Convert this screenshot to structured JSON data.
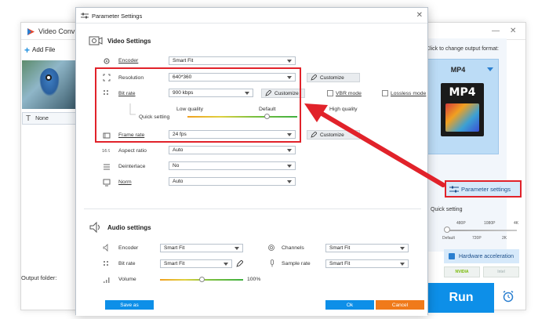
{
  "app": {
    "title": "Video Conv",
    "add_files": "Add File",
    "subtitle_value": "None",
    "output_folder_label": "Output folder:",
    "run_label": "Run"
  },
  "right_panel": {
    "change_format_label": "Click to change output format:",
    "format_name": "MP4",
    "format_icon_text": "MP4",
    "parameter_settings_label": "Parameter settings",
    "quick_setting_label": "Quick setting",
    "quick_scale_top": [
      "480P",
      "1080P",
      "4K"
    ],
    "quick_scale_bottom": [
      "Default",
      "720P",
      "2K"
    ],
    "hw_accel_label": "Hardware acceleration",
    "gpu_nvidia": "NVIDIA",
    "gpu_intel": "Intel"
  },
  "dialog": {
    "title": "Parameter Settings",
    "video_section": "Video Settings",
    "audio_section": "Audio settings",
    "video": {
      "encoder_label": "Encoder",
      "encoder_value": "Smart Fit",
      "resolution_label": "Resolution",
      "resolution_value": "640*360",
      "customize": "Customize",
      "bitrate_label": "Bit rate",
      "bitrate_value": "900 kbps",
      "vbr_label": "VBR mode",
      "lossless_label": "Lossless mode",
      "low_quality": "Low quality",
      "default_quality": "Default",
      "high_quality": "High quality",
      "quick_setting": "Quick setting",
      "framerate_label": "Frame rate",
      "framerate_value": "24 fps",
      "aspect_label": "Aspect ratio",
      "aspect_value": "Auto",
      "deinterlace_label": "Deinterlace",
      "deinterlace_value": "No",
      "norm_label": "Norm",
      "norm_value": "Auto"
    },
    "audio": {
      "encoder_label": "Encoder",
      "encoder_value": "Smart Fit",
      "channels_label": "Channels",
      "channels_value": "Smart Fit",
      "bitrate_label": "Bit rate",
      "bitrate_value": "Smart Fit",
      "samplerate_label": "Sample rate",
      "samplerate_value": "Smart Fit",
      "volume_label": "Volume",
      "volume_value": "100%",
      "volume_level": 0.5
    },
    "save_as": "Save as",
    "ok": "Ok",
    "cancel": "Cancel"
  },
  "colors": {
    "accent_blue": "#0d8fe8",
    "annotation_red": "#e1222a",
    "cancel_orange": "#f07a1a",
    "format_box": "#bcdcf6"
  }
}
